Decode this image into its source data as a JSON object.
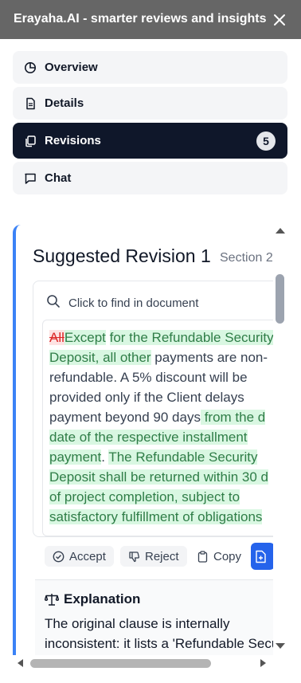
{
  "header": {
    "title": "Erayaha.AI - smarter reviews and insights",
    "close_icon": "close-icon"
  },
  "nav": {
    "items": [
      {
        "label": "Overview",
        "icon": "pie-chart-icon"
      },
      {
        "label": "Details",
        "icon": "document-icon"
      },
      {
        "label": "Revisions",
        "icon": "copy-icon",
        "badge": "5",
        "active": true
      },
      {
        "label": "Chat",
        "icon": "chat-icon"
      }
    ]
  },
  "revision": {
    "title": "Suggested Revision 1",
    "section": "Section 2",
    "find_placeholder": "Click to find in document",
    "clause_lines": [
      [
        {
          "t": "All",
          "k": "del"
        },
        {
          "t": "Except",
          "k": "ins"
        },
        {
          "t": " ",
          "k": ""
        },
        {
          "t": "for the Refundable Security",
          "k": "ins"
        }
      ],
      [
        {
          "t": "Deposit, all other",
          "k": "ins"
        },
        {
          "t": " payments are non-",
          "k": ""
        }
      ],
      [
        {
          "t": "refundable. A 5% discount will be",
          "k": ""
        }
      ],
      [
        {
          "t": "provided only if the Client delays",
          "k": ""
        }
      ],
      [
        {
          "t": "payment beyond 90 days",
          "k": ""
        },
        {
          "t": " from the d",
          "k": "ins"
        }
      ],
      [
        {
          "t": "date of the respective installment",
          "k": "ins"
        }
      ],
      [
        {
          "t": "payment",
          "k": "ins"
        },
        {
          "t": ". ",
          "k": ""
        },
        {
          "t": "The Refundable Security",
          "k": "ins"
        }
      ],
      [
        {
          "t": "Deposit shall be returned within 30 d",
          "k": "ins"
        }
      ],
      [
        {
          "t": "of project completion, subject to",
          "k": "ins"
        }
      ],
      [
        {
          "t": "satisfactory fulfillment of obligations",
          "k": "ins"
        }
      ]
    ],
    "actions": {
      "accept": "Accept",
      "reject": "Reject",
      "copy": "Copy"
    },
    "explanation": {
      "title": "Explanation",
      "text_lines": [
        "The original clause is internally",
        "inconsistent: it lists a 'Refundable Secu"
      ]
    }
  },
  "colors": {
    "accent": "#3b82f6",
    "active_tab": "#0f172a",
    "insert_bg": "#d9f7e2",
    "delete_bg": "#fde2e2",
    "primary": "#2563eb"
  }
}
